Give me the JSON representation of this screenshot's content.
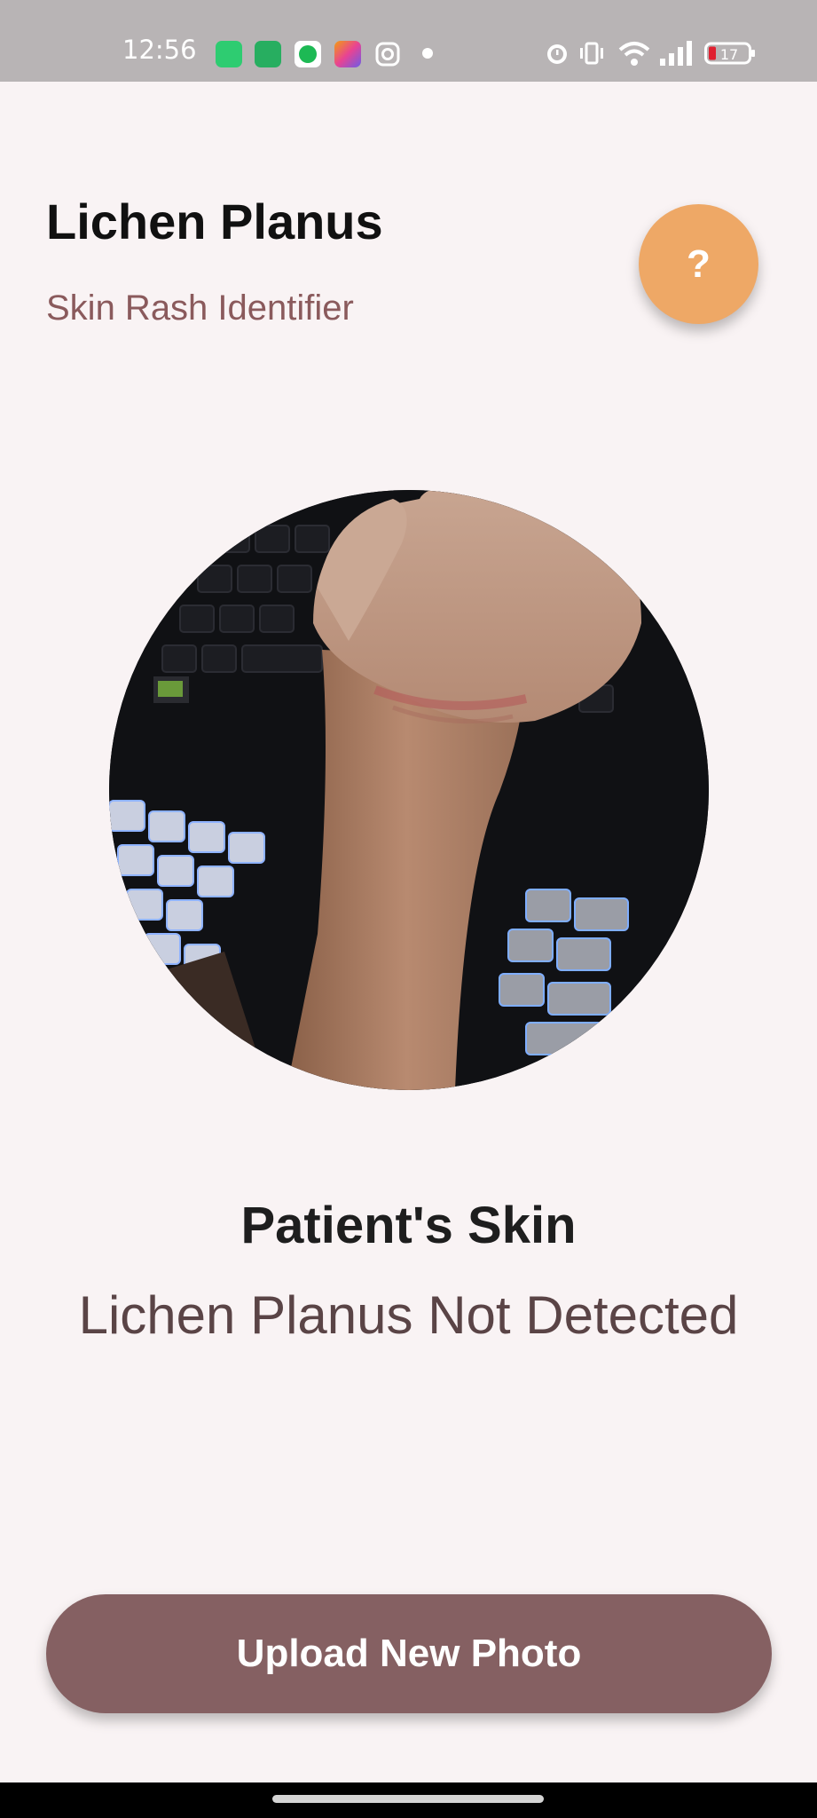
{
  "status_bar": {
    "time": "12:56",
    "notification_icons": [
      "battery-saver-icon",
      "app-icon",
      "spotify-icon",
      "colorful-app-icon",
      "instagram-icon",
      "dot-icon"
    ],
    "system_icons": [
      "alarm-icon",
      "vibrate-icon",
      "wifi-icon",
      "signal-icon",
      "battery-icon"
    ],
    "battery_level": "17"
  },
  "header": {
    "title": "Lichen Planus",
    "subtitle": "Skin Rash Identifier",
    "help_label": "?"
  },
  "result": {
    "title": "Patient's Skin",
    "status": "Lichen Planus Not Detected"
  },
  "actions": {
    "upload_label": "Upload New Photo"
  },
  "colors": {
    "background": "#f9f3f4",
    "accent_help": "#eea866",
    "primary_button": "#856062",
    "subtitle": "#8a5a5c"
  }
}
